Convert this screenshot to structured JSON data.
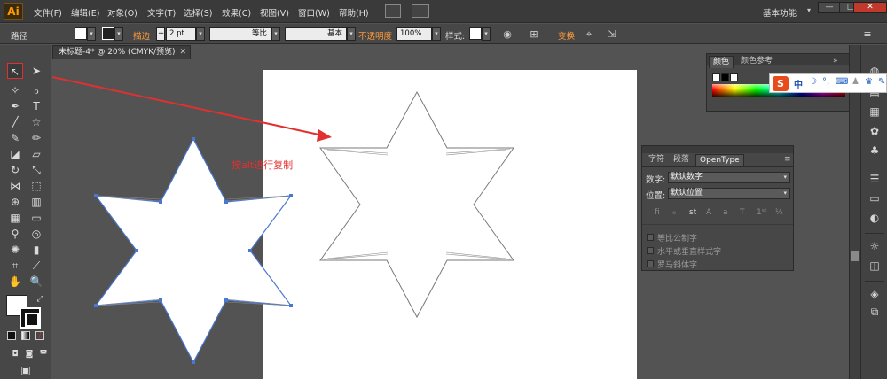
{
  "app": {
    "logo": "Ai",
    "workspace": "基本功能"
  },
  "menu": [
    "文件(F)",
    "编辑(E)",
    "对象(O)",
    "文字(T)",
    "选择(S)",
    "效果(C)",
    "视图(V)",
    "窗口(W)",
    "帮助(H)"
  ],
  "window_buttons": {
    "minimize": "—",
    "maximize": "□",
    "close": "✕"
  },
  "control_bar": {
    "selection_type": "路径",
    "stroke_label": "描边",
    "stroke_weight": "2 pt",
    "profile_uniform": "等比",
    "brush_basic": "基本",
    "opacity_label": "不透明度",
    "opacity_value": "100%",
    "style_label": "样式:",
    "transform_label": "变换"
  },
  "document_tab": {
    "title": "未标题-4* @ 20% (CMYK/预览)",
    "close": "✕"
  },
  "annotation": "按alt进行复制",
  "color_panel": {
    "tab_color": "颜色",
    "tab_guide": "颜色参考"
  },
  "ime": {
    "logo": "S",
    "lang": "中",
    "moon": "☽",
    "punct": "°,",
    "keyboard": "⌨",
    "user": "♟",
    "shirt": "♛"
  },
  "char_panel": {
    "tabs": [
      "字符",
      "段落",
      "OpenType"
    ],
    "figure_label": "数字:",
    "figure_value": "默认数字",
    "position_label": "位置:",
    "position_value": "默认位置",
    "checkboxes": [
      "等比公制字",
      "水平或垂直样式字",
      "罗马斜体字"
    ]
  },
  "colors": {
    "accent_red": "#e03030",
    "star_outline": "#4a78d0",
    "artboard": "#ffffff",
    "bg": "#535353"
  }
}
